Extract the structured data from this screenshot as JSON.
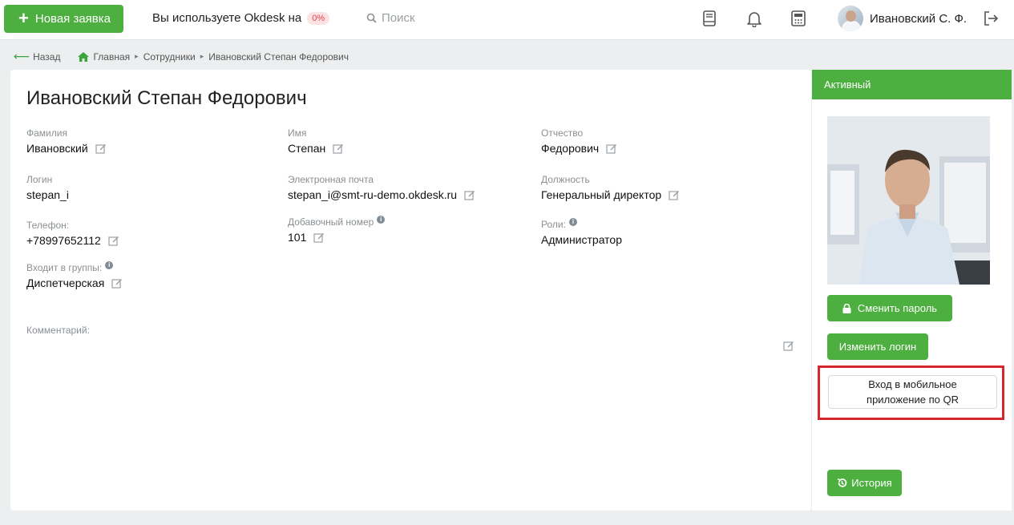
{
  "topbar": {
    "new_request": "Новая заявка",
    "usage_text": "Вы используете Okdesk на",
    "usage_percent": "0%",
    "search_placeholder": "Поиск",
    "user_name": "Ивановский С. Ф."
  },
  "breadcrumb": {
    "back": "Назад",
    "home": "Главная",
    "employees": "Сотрудники",
    "current": "Ивановский Степан Федорович"
  },
  "profile": {
    "full_name": "Ивановский Степан Федорович",
    "last_name_label": "Фамилия",
    "last_name": "Ивановский",
    "first_name_label": "Имя",
    "first_name": "Степан",
    "patronymic_label": "Отчество",
    "patronymic": "Федорович",
    "login_label": "Логин",
    "login": "stepan_i",
    "email_label": "Электронная почта",
    "email": "stepan_i@smt-ru-demo.okdesk.ru",
    "position_label": "Должность",
    "position": "Генеральный директор",
    "phone_label": "Телефон:",
    "phone": "+78997652112",
    "ext_label": "Добавочный номер",
    "ext": "101",
    "roles_label": "Роли:",
    "roles": "Администратор",
    "groups_label": "Входит в группы:",
    "groups": "Диспетчерская",
    "comment_label": "Комментарий:"
  },
  "side": {
    "status": "Активный",
    "change_password": "Сменить пароль",
    "change_login": "Изменить логин",
    "qr_line1": "Вход в мобильное",
    "qr_line2": "приложение по QR",
    "history": "История"
  },
  "colors": {
    "accent": "#4caf3f",
    "highlight": "#d8262d"
  }
}
